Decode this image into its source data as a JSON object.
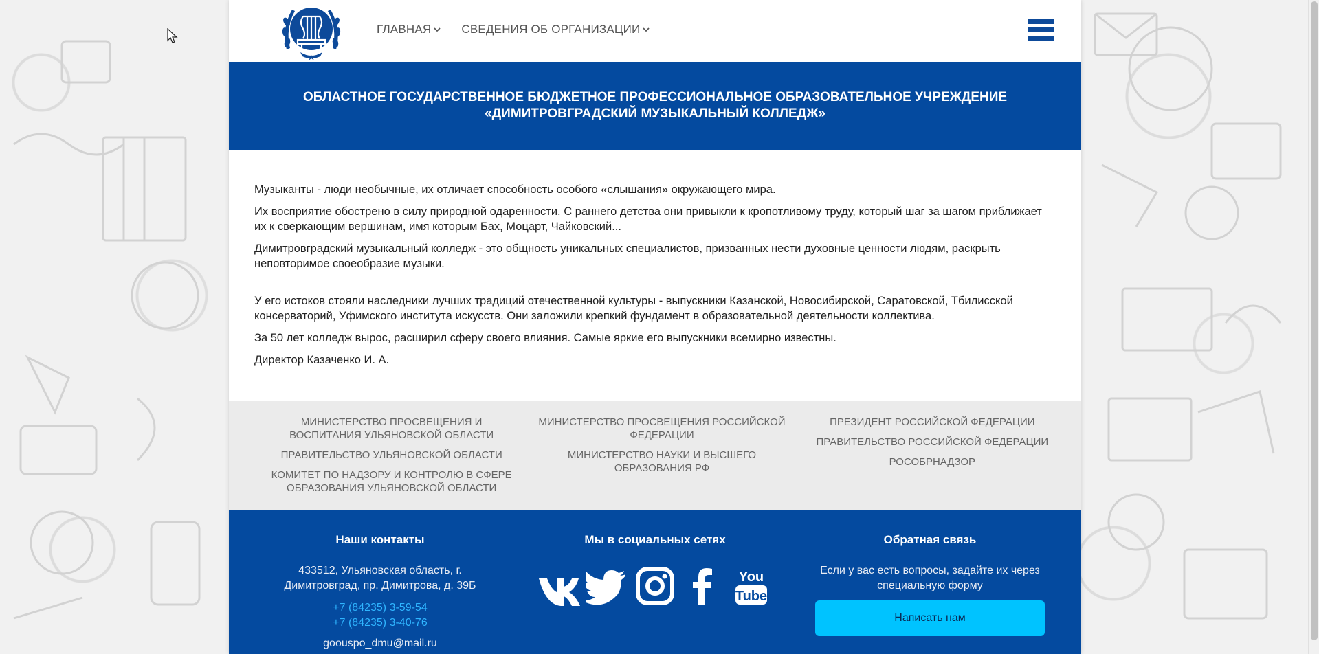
{
  "nav": {
    "items": [
      {
        "label": "ГЛАВНАЯ"
      },
      {
        "label": "СВЕДЕНИЯ ОБ ОРГАНИЗАЦИИ"
      }
    ]
  },
  "banner": {
    "line1": "ОБЛАСТНОЕ ГОСУДАРСТВЕННОЕ БЮДЖЕТНОЕ ПРОФЕССИОНАЛЬНОЕ ОБРАЗОВАТЕЛЬНОЕ УЧРЕЖДЕНИЕ",
    "line2": "«ДИМИТРОВГРАДСКИЙ МУЗЫКАЛЬНЫЙ КОЛЛЕДЖ»"
  },
  "content": {
    "paragraphs": [
      "Музыканты - люди необычные, их отличает способность особого «слышания» окружающего мира.",
      "Их восприятие обострено в силу природной одаренности. С раннего детства они привыкли к кропотливому труду, который шаг за шагом приближает их к сверкающим вершинам, имя которым Бах, Моцарт, Чайковский...",
      "Димитровградский музыкальный колледж - это общность уникальных специалистов, призванных нести духовные ценности людям, раскрыть неповторимое своеобразие музыки.",
      "У его истоков стояли наследники лучших традиций отечественной культуры - выпускники Казанской, Новосибирской, Саратовской, Тбилисской консерваторий, Уфимского института искусств. Они заложили крепкий фундамент в образовательной деятельности коллектива.",
      "За 50 лет колледж вырос, расширил сферу своего влияния. Самые яркие его выпускники всемирно известны.",
      "Директор Казаченко И. А."
    ]
  },
  "links": {
    "col1": [
      "МИНИСТЕРСТВО ПРОСВЕЩЕНИЯ И ВОСПИТАНИЯ УЛЬЯНОВСКОЙ ОБЛАСТИ",
      "ПРАВИТЕЛЬСТВО УЛЬЯНОВСКОЙ ОБЛАСТИ",
      "КОМИТЕТ ПО НАДЗОРУ И КОНТРОЛЮ В СФЕРЕ ОБРАЗОВАНИЯ УЛЬЯНОВСКОЙ ОБЛАСТИ"
    ],
    "col2": [
      "МИНИСТЕРСТВО ПРОСВЕЩЕНИЯ РОССИЙСКОЙ ФЕДЕРАЦИИ",
      "МИНИСТЕРСТВО НАУКИ И ВЫСШЕГО ОБРАЗОВАНИЯ РФ"
    ],
    "col3": [
      "ПРЕЗИДЕНТ РОССИЙСКОЙ ФЕДЕРАЦИИ",
      "ПРАВИТЕЛЬСТВО РОССИЙСКОЙ ФЕДЕРАЦИИ",
      "РОСОБРНАДЗОР"
    ]
  },
  "footer": {
    "contacts": {
      "title": "Наши контакты",
      "address": "433512, Ульяновская область, г. Димитровград, пр. Димитрова, д. 39Б",
      "phone1": "+7 (84235) 3-59-54",
      "phone2": "+7 (84235) 3-40-76",
      "email": "goouspo_dmu@mail.ru"
    },
    "social": {
      "title": "Мы в социальных сетях",
      "icons": [
        "vk-icon",
        "twitter-icon",
        "instagram-icon",
        "facebook-icon",
        "youtube-icon"
      ]
    },
    "feedback": {
      "title": "Обратная связь",
      "description": "Если у вас есть вопросы, задайте их через специальную форму",
      "button": "Написать нам"
    }
  },
  "colors": {
    "brand_blue": "#044a9f",
    "link_cyan": "#2fb5ff",
    "button_cyan": "#00c3ff"
  }
}
